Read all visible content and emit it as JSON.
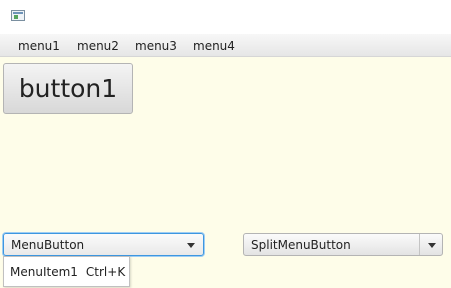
{
  "menubar": {
    "items": [
      "menu1",
      "menu2",
      "menu3",
      "menu4"
    ]
  },
  "main": {
    "big_button_label": "button1",
    "menu_button_label": "MenuButton",
    "split_menu_button_label": "SplitMenuButton"
  },
  "popup": {
    "item_label": "MenuItem1",
    "item_accelerator": "Ctrl+K"
  },
  "icons": {
    "app": "app-window-icon",
    "dropdown": "chevron-down-icon"
  },
  "colors": {
    "background": "#fefde9",
    "focus_border": "#3d97e0"
  }
}
